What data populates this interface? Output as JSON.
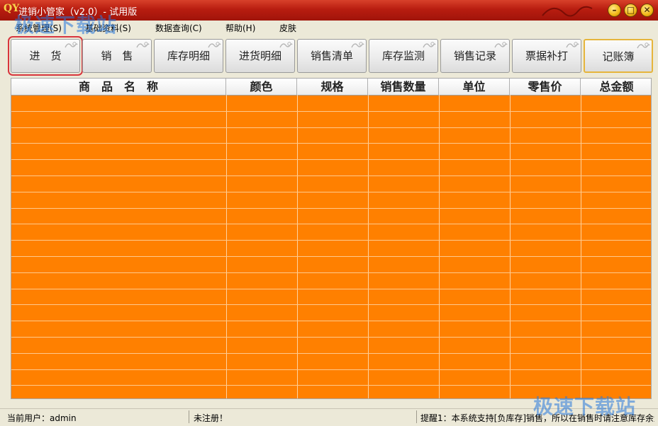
{
  "window": {
    "title": "进销小管家（v2.0）- 试用版",
    "logo": "QY",
    "buttons": [
      "minimize",
      "maximize",
      "close"
    ]
  },
  "menu": [
    {
      "label": "系统管理(S)"
    },
    {
      "label": "基础资料(S)"
    },
    {
      "label": "数据查询(C)"
    },
    {
      "label": "帮助(H)"
    },
    {
      "label": "皮肤"
    }
  ],
  "toolbar": [
    {
      "label": "进　货",
      "state": "focused"
    },
    {
      "label": "销　售"
    },
    {
      "label": "库存明细"
    },
    {
      "label": "进货明细"
    },
    {
      "label": "销售清单"
    },
    {
      "label": "库存监测"
    },
    {
      "label": "销售记录"
    },
    {
      "label": "票据补打"
    },
    {
      "label": "记账簿",
      "state": "highlighted"
    }
  ],
  "grid": {
    "columns": [
      "商　品　名　称",
      "颜色",
      "规格",
      "销售数量",
      "单位",
      "零售价",
      "总金额"
    ],
    "rows": []
  },
  "status": {
    "user": "当前用户：admin",
    "register": "未注册！",
    "tip": "提醒1：本系统支持[负库存]销售，所以在销售时请注意库存余量"
  },
  "watermark": {
    "text": "极速下载站"
  },
  "colors": {
    "titlebar": "#b81d10",
    "grid_background": "#ff8000",
    "focus_frame": "#d8353d",
    "highlight_border": "#e6b53c"
  }
}
